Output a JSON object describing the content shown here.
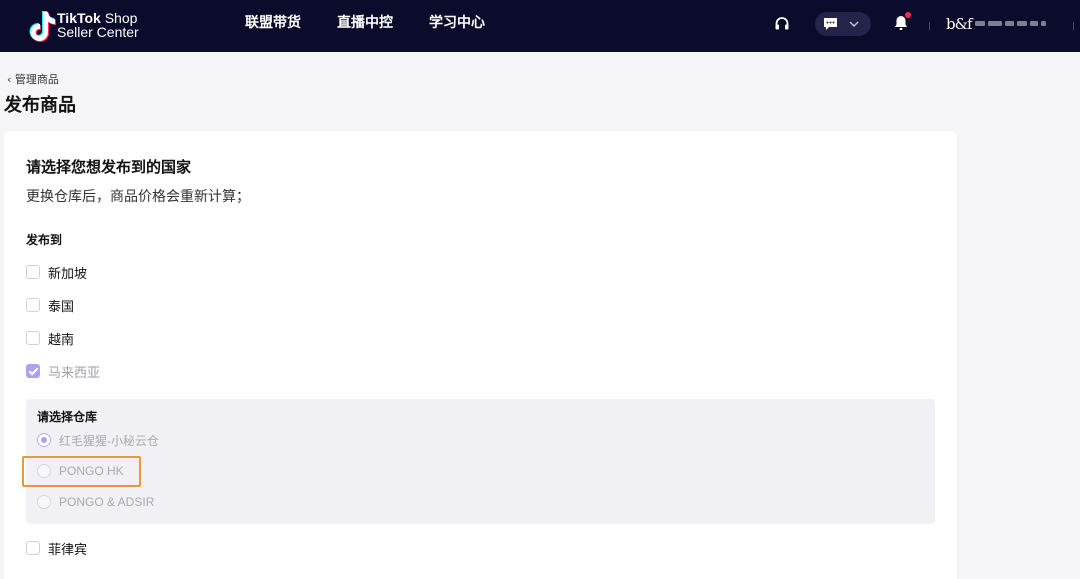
{
  "header": {
    "brand_line1_bold": "TikTok",
    "brand_line1_rest": " Shop",
    "brand_line2": "Seller Center",
    "nav": [
      "联盟带货",
      "直播中控",
      "学习中心"
    ],
    "shop_logo_text": "b&f",
    "brand_color": "#0b0b2b",
    "notification_dot_color": "#fe2c55"
  },
  "page": {
    "back_label": "管理商品",
    "title": "发布商品"
  },
  "form": {
    "title": "请选择您想发布到的国家",
    "subtitle": "更换仓库后，商品价格会重新计算；",
    "publish_label": "发布到",
    "countries": [
      {
        "label": "新加坡",
        "checked": false
      },
      {
        "label": "泰国",
        "checked": false
      },
      {
        "label": "越南",
        "checked": false
      },
      {
        "label": "马来西亚",
        "checked": true
      },
      {
        "label": "菲律宾",
        "checked": false
      }
    ],
    "warehouse": {
      "title": "请选择仓库",
      "options": [
        {
          "label": "红毛猩猩-小秘云仓",
          "selected": true
        },
        {
          "label": "PONGO HK",
          "selected": false
        },
        {
          "label": "PONGO & ADSIR",
          "selected": false
        }
      ]
    }
  },
  "icons": {
    "support": "headset-icon",
    "message": "chat-icon",
    "dropdown": "chevron-down-icon",
    "notifications": "bell-icon",
    "back": "chevron-left-icon"
  },
  "accent_color": "#a9a3f5",
  "highlight_color": "#e8993b"
}
